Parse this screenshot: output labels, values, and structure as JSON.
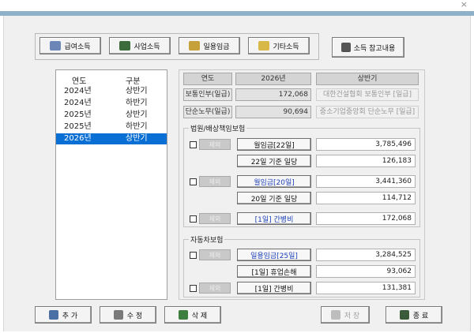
{
  "window": {
    "close_glyph": "×"
  },
  "top_buttons": {
    "salary": "급여소득",
    "business": "사업소득",
    "daily_wage": "일용임금",
    "other": "기타소득",
    "reference": "소득 참고내용"
  },
  "list": {
    "col_year": "연도",
    "col_half": "구분",
    "rows": [
      {
        "year": "2024년",
        "half": "상반기"
      },
      {
        "year": "2024년",
        "half": "하반기"
      },
      {
        "year": "2025년",
        "half": "상반기"
      },
      {
        "year": "2025년",
        "half": "하반기"
      },
      {
        "year": "2026년",
        "half": "상반기",
        "selected": true
      }
    ]
  },
  "header_row": {
    "year_label": "연도",
    "year_value": "2026년",
    "half_value": "상반기"
  },
  "info_rows": [
    {
      "label": "보통인부(일급)",
      "value": "172,068",
      "note": "대한건설협회 보통인부 [일급]"
    },
    {
      "label": "단순노무(일급)",
      "value": "90,694",
      "note": "중소기업중앙회 단순노무 [일급]"
    }
  ],
  "court_group": {
    "title": "법원/배상책임보험",
    "items": [
      {
        "check_label": "제외",
        "name": "월임금[22일]",
        "amount": "3,785,496",
        "has_check": true,
        "blue": false
      },
      {
        "name": "22일 기준 일당",
        "amount": "126,183",
        "has_check": false,
        "blue": false
      },
      {
        "check_label": "제외",
        "name": "월임금[20일]",
        "amount": "3,441,360",
        "has_check": true,
        "blue": true
      },
      {
        "name": "20일 기준 일당",
        "amount": "114,712",
        "has_check": false,
        "blue": false
      },
      {
        "check_label": "제외",
        "name": "[1일] 간병비",
        "amount": "172,068",
        "has_check": true,
        "blue": true
      }
    ]
  },
  "auto_group": {
    "title": "자동차보험",
    "items": [
      {
        "check_label": "제외",
        "name": "일용임금[25일]",
        "amount": "3,284,525",
        "has_check": true,
        "blue": true
      },
      {
        "name": "[1일] 휴업손해",
        "amount": "93,062",
        "has_check": false,
        "blue": false
      },
      {
        "check_label": "제외",
        "name": "[1일] 간병비",
        "amount": "131,381",
        "has_check": true,
        "blue": false
      }
    ]
  },
  "bottom_buttons": {
    "add": "추 가",
    "edit": "수 정",
    "delete": "삭 제",
    "save": "저 장",
    "exit": "종 료"
  }
}
